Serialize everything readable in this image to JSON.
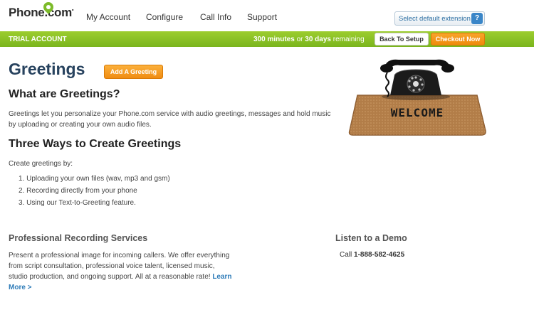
{
  "brand": {
    "name": "Phone",
    "suffix": ".com",
    "accent": "#7dbb2a"
  },
  "nav": {
    "items": [
      "My Account",
      "Configure",
      "Call Info",
      "Support"
    ]
  },
  "extension_button": {
    "label": "Select default extension",
    "help": "?"
  },
  "trial_bar": {
    "label": "TRIAL ACCOUNT",
    "minutes": "300 minutes",
    "or": " or ",
    "days": "30 days",
    "remaining": " remaining",
    "back_button": "Back To Setup",
    "checkout_button": "Checkout Now",
    "color": "#8cc222"
  },
  "page": {
    "title": "Greetings",
    "add_button": "Add A Greeting",
    "what_heading": "What are Greetings?",
    "what_text_line1": "Greetings let you personalize your Phone.com service with audio greetings, messages and hold music",
    "what_text_line2": "by uploading or creating your own audio files.",
    "three_heading": "Three Ways to Create Greetings",
    "create_intro": "Create greetings by:",
    "steps": [
      "1.  Uploading your own files (wav, mp3 and gsm)",
      "2.  Recording directly from your phone",
      "3.  Using our Text-to-Greeting feature."
    ]
  },
  "illustration": {
    "mat_text": "WELCOME",
    "icon": "telephone-on-welcome-mat"
  },
  "pro_services": {
    "title": "Professional Recording Services",
    "line1": "Present a professional image for incoming callers. We offer everything",
    "line2": "from script consultation, professional voice talent, licensed music,",
    "line3": "studio production, and ongoing support. All at a reasonable rate! ",
    "learn_more_1": "Learn",
    "learn_more_2": "More >"
  },
  "demo": {
    "title": "Listen to a Demo",
    "call_prefix": "Call ",
    "phone": "1-888-582-4625"
  }
}
